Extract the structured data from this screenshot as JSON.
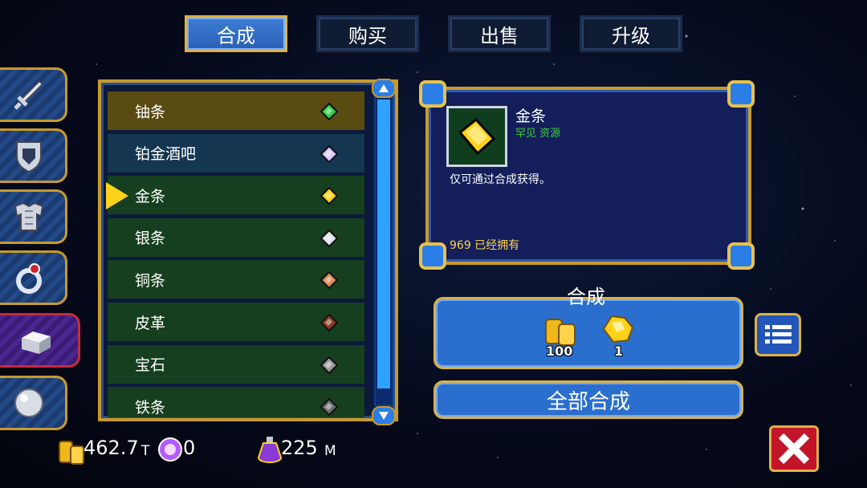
{
  "tabs": [
    {
      "label": "合成",
      "active": true
    },
    {
      "label": "购买",
      "active": false
    },
    {
      "label": "出售",
      "active": false
    },
    {
      "label": "升级",
      "active": false
    }
  ],
  "sidebar": {
    "icons": [
      "sword-icon",
      "shield-icon",
      "armor-icon",
      "ring-icon",
      "ingot-icon",
      "orb-icon"
    ],
    "active_index": 4
  },
  "list": {
    "items": [
      {
        "name": "铀条",
        "icon": "green-gem-icon",
        "color": "#2fd04a"
      },
      {
        "name": "铂金酒吧",
        "icon": "platinum-gem-icon",
        "color": "#d9c9ff"
      },
      {
        "name": "金条",
        "icon": "gold-bar-icon",
        "color": "#ffd21a"
      },
      {
        "name": "银条",
        "icon": "silver-bar-icon",
        "color": "#e0e4ea"
      },
      {
        "name": "铜条",
        "icon": "copper-bar-icon",
        "color": "#d98a5a"
      },
      {
        "name": "皮革",
        "icon": "leather-icon",
        "color": "#8a3b1f"
      },
      {
        "name": "宝石",
        "icon": "stone-icon",
        "color": "#9a9a9a"
      },
      {
        "name": "铁条",
        "icon": "iron-bar-icon",
        "color": "#6e6e6e"
      }
    ],
    "selected_index": 2
  },
  "detail": {
    "name": "金条",
    "subtitle": "罕见 资源",
    "description": "仅可通过合成获得。",
    "owned": "969 已经拥有"
  },
  "craft": {
    "label": "合成",
    "materials": [
      {
        "icon": "gold-coins-icon",
        "count": "100"
      },
      {
        "icon": "gold-nugget-icon",
        "count": "1"
      }
    ],
    "craft_all_label": "全部合成"
  },
  "currency": {
    "gold_value": "462.7",
    "gold_unit": "T",
    "gem_value": "0",
    "potion_value": "225",
    "potion_unit": "M"
  },
  "colors": {
    "accent_gold": "#c79a2b",
    "button_blue": "#2a6fce",
    "close_red": "#c3152a"
  }
}
